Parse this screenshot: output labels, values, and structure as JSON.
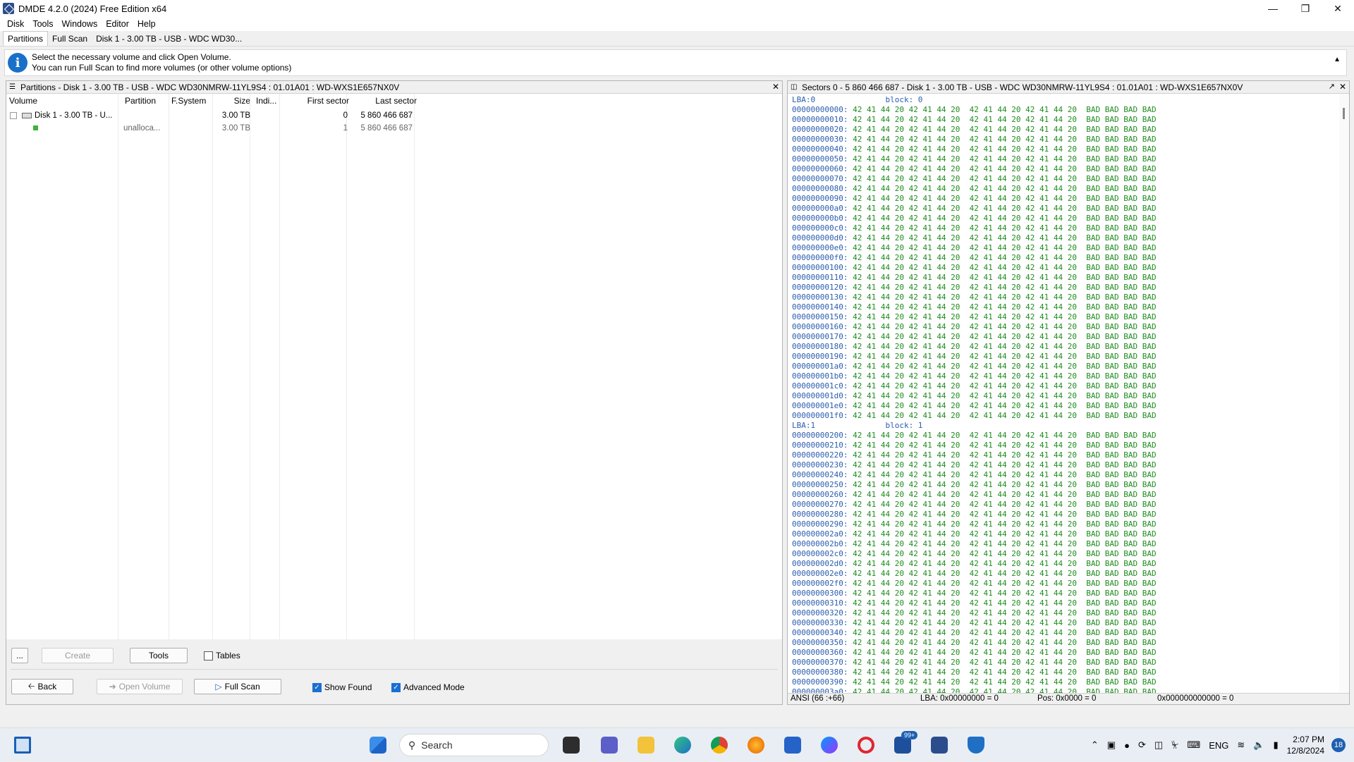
{
  "window": {
    "title": "DMDE 4.2.0 (2024) Free Edition x64"
  },
  "menu": [
    "Disk",
    "Tools",
    "Windows",
    "Editor",
    "Help"
  ],
  "tabs": [
    "Partitions",
    "Full Scan",
    "Disk 1 - 3.00 TB - USB - WDC WD30..."
  ],
  "info": {
    "line1": "Select the necessary volume and click Open Volume.",
    "line2": "You can run Full Scan to find more volumes (or other volume options)"
  },
  "partitions_panel": {
    "title": "Partitions - Disk 1 - 3.00 TB - USB - WDC WD30NMRW-11YL9S4 : 01.01A01 : WD-WXS1E657NX0V",
    "columns": [
      "Volume",
      "Partition",
      "F.System",
      "Size",
      "Indi...",
      "First sector",
      "Last sector"
    ],
    "rows": [
      {
        "volume": "Disk 1 - 3.00 TB - U...",
        "partition": "",
        "fs": "",
        "size": "3.00 TB",
        "indi": "",
        "first": "0",
        "last": "5 860 466 687"
      },
      {
        "volume": "",
        "partition": "unalloca...",
        "fs": "",
        "size": "3.00 TB",
        "indi": "",
        "first": "1",
        "last": "5 860 466 687"
      }
    ],
    "buttons": {
      "more": "...",
      "create": "Create",
      "tools": "Tools",
      "tables": "Tables",
      "back": "Back",
      "open_volume": "Open Volume",
      "full_scan": "Full Scan",
      "show_found": "Show Found",
      "advanced_mode": "Advanced Mode"
    }
  },
  "sectors_panel": {
    "title": "Sectors 0 - 5 860 466 687 - Disk 1 - 3.00 TB - USB - WDC WD30NMRW-11YL9S4 : 01.01A01 : WD-WXS1E657NX0V",
    "blocks": [
      {
        "lba": "LBA:0",
        "block": "block: 0",
        "start": 0
      },
      {
        "lba": "LBA:1",
        "block": "block: 1",
        "start": 512
      }
    ],
    "hex_bytes": "42 41 44 20 42 41 44 20  42 41 44 20 42 41 44 20",
    "ascii": "BAD BAD BAD BAD",
    "status": {
      "encoding": "ANSI (66 :+66)",
      "lba": "LBA: 0x00000000 = 0",
      "pos": "Pos: 0x0000 = 0",
      "offset": "0x000000000000 = 0"
    }
  },
  "taskbar": {
    "search_placeholder": "Search",
    "badge": "99+",
    "lang": "ENG",
    "time": "2:07 PM",
    "date": "12/8/2024",
    "notifications": "18"
  }
}
